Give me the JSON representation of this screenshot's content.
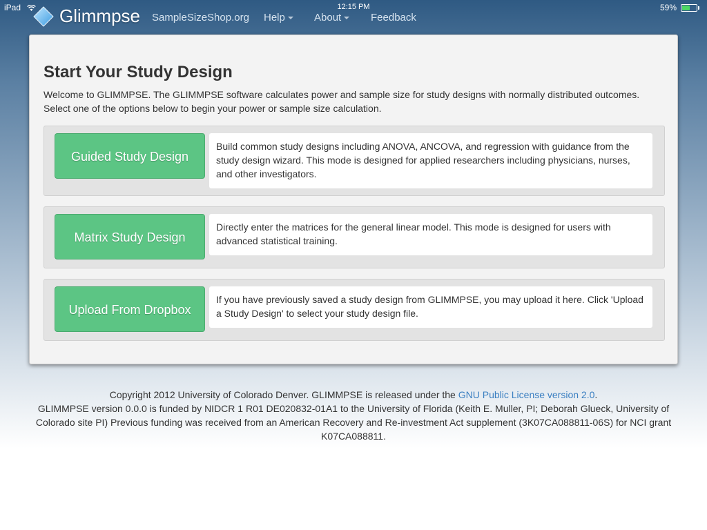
{
  "statusbar": {
    "device": "iPad",
    "time": "12:15 PM",
    "battery": "59%",
    "battery_level": 0.59
  },
  "nav": {
    "brand": "Glimmpse",
    "items": [
      "SampleSizeShop.org",
      "Help",
      "About",
      "Feedback"
    ]
  },
  "main": {
    "title": "Start Your Study Design",
    "intro": "Welcome to GLIMMPSE. The GLIMMPSE software calculates power and sample size for study designs with normally distributed outcomes. Select one of the options below to begin your power or sample size calculation.",
    "options": [
      {
        "button": "Guided Study Design",
        "description": "Build common study designs including ANOVA, ANCOVA, and regression with guidance from the study design wizard. This mode is designed for applied researchers including physicians, nurses, and other investigators."
      },
      {
        "button": "Matrix Study Design",
        "description": "Directly enter the matrices for the general linear model. This mode is designed for users with advanced statistical training."
      },
      {
        "button": "Upload From Dropbox",
        "description": "If you have previously saved a study design from GLIMMPSE, you may upload it here. Click 'Upload a Study Design' to select your study design file."
      }
    ]
  },
  "footer": {
    "copyright_prefix": "Copyright 2012 University of Colorado Denver. GLIMMPSE is released under the ",
    "license_link": "GNU Public License version 2.0",
    "copyright_suffix": ".",
    "funding": "GLIMMPSE version 0.0.0 is funded by NIDCR 1 R01 DE020832-01A1 to the University of Florida (Keith E. Muller, PI; Deborah Glueck, University of Colorado site PI) Previous funding was received from an American Recovery and Re-investment Act supplement (3K07CA088811-06S) for NCI grant K07CA088811."
  }
}
